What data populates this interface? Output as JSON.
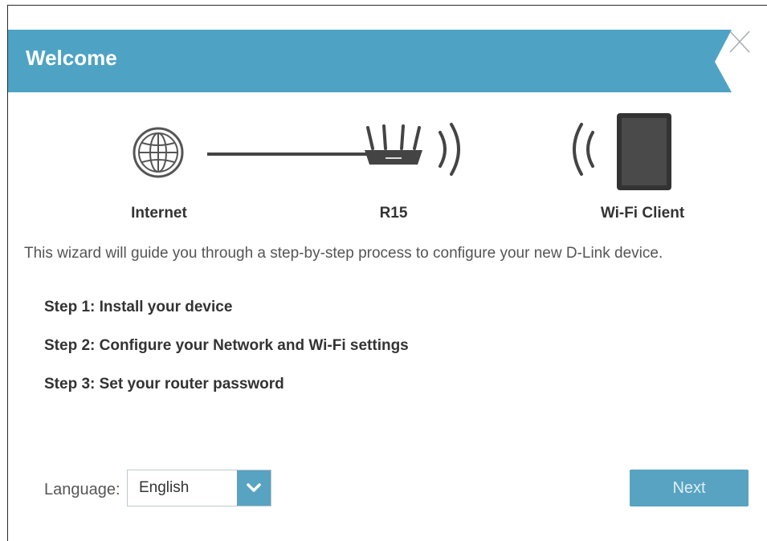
{
  "dialog": {
    "title": "Welcome",
    "close_icon": "close-x-icon"
  },
  "diagram": {
    "internet_label": "Internet",
    "router_label": "R15",
    "client_label": "Wi-Fi Client",
    "icons": [
      "globe-icon",
      "router-icon",
      "wifi-signal-icon",
      "tablet-icon"
    ]
  },
  "intro_text": "This wizard will guide you through a step-by-step process to configure your new D-Link device.",
  "steps": [
    "Step 1: Install your device",
    "Step 2: Configure your Network and Wi-Fi settings",
    "Step 3: Set your router password"
  ],
  "language": {
    "label": "Language:",
    "selected": "English"
  },
  "next_label": "Next",
  "colors": {
    "accent": "#58a3c2",
    "header": "#4ea3c4"
  }
}
